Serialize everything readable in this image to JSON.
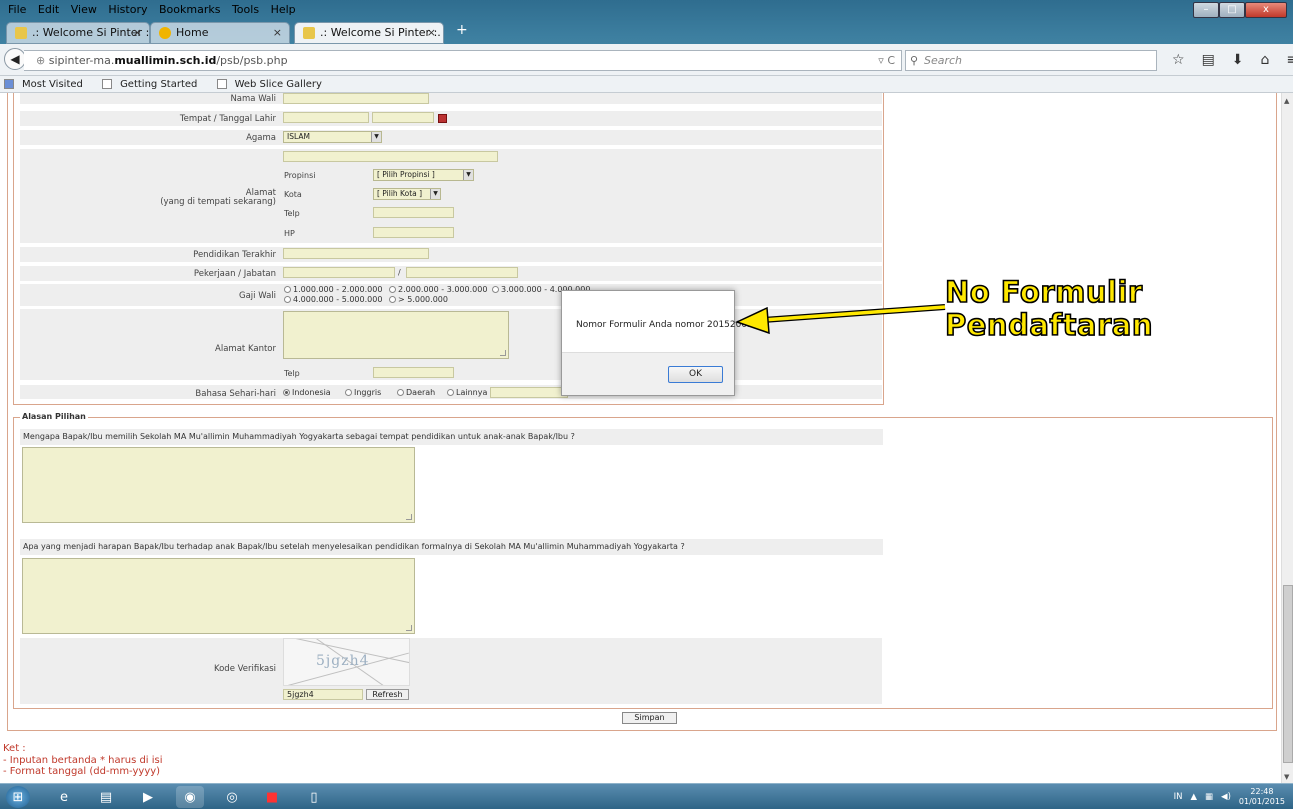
{
  "browser": {
    "menu": [
      "File",
      "Edit",
      "View",
      "History",
      "Bookmarks",
      "Tools",
      "Help"
    ],
    "tabs": [
      {
        "label": ".: Welcome Si Pinter :.",
        "close": "×"
      },
      {
        "label": "Home",
        "close": "×"
      },
      {
        "label": ".: Welcome Si Pinter :.",
        "close": "×"
      }
    ],
    "new_tab": "+",
    "url_prefix": "sipinter-ma.",
    "url_domain": "muallimin.sch.id",
    "url_path": "/psb/psb.php",
    "url_end": "▿ C",
    "search_placeholder": "Search",
    "bookmarks": [
      "Most Visited",
      "Getting Started",
      "Web Slice Gallery"
    ],
    "window_buttons": {
      "min": "–",
      "max": "□",
      "close": "x"
    }
  },
  "form": {
    "nama_wali": "Nama Wali",
    "tempat_tgl": "Tempat / Tanggal Lahir",
    "slash": "/",
    "agama": "Agama",
    "agama_value": "ISLAM",
    "propinsi": "Propinsi",
    "propinsi_value": "[ Pilih Propinsi ]",
    "alamat": "Alamat",
    "alamat_sub": "(yang di tempati sekarang)",
    "kota": "Kota",
    "kota_value": "[ Pilih Kota ]",
    "telp": "Telp",
    "hp": "HP",
    "pendidikan": "Pendidikan Terakhir",
    "pekerjaan": "Pekerjaan / Jabatan",
    "gaji": "Gaji Wali",
    "gaji_opts": [
      "1.000.000 - 2.000.000",
      "2.000.000 - 3.000.000",
      "3.000.000 - 4.000.000",
      "4.000.000 - 5.000.000",
      "> 5.000.000"
    ],
    "alamat_kantor": "Alamat Kantor",
    "telp2": "Telp",
    "bahasa": "Bahasa Sehari-hari",
    "bahasa_opts": [
      "Indonesia",
      "Inggris",
      "Daerah",
      "Lainnya"
    ]
  },
  "alasan": {
    "legend": "Alasan Pilihan",
    "q1": "Mengapa Bapak/Ibu memilih Sekolah MA Mu'allimin Muhammadiyah Yogyakarta sebagai tempat pendidikan untuk anak-anak Bapak/Ibu ?",
    "q2": "Apa yang menjadi harapan Bapak/Ibu terhadap anak Bapak/Ibu setelah menyelesaikan pendidikan formalnya di Sekolah MA Mu'allimin Muhammadiyah Yogyakarta ?",
    "kode_label": "Kode Verifikasi",
    "captcha_text": "5jgzh4",
    "captcha_input": "5jgzh4",
    "refresh": "Refresh"
  },
  "simpan": "Simpan",
  "ket": {
    "title": "Ket :",
    "line1": "- Inputan bertanda * harus di isi",
    "line2": "- Format tanggal (dd-mm-yyyy)"
  },
  "dialog": {
    "message": "Nomor Formulir Anda nomor 20152003",
    "ok": "OK"
  },
  "annotation": {
    "line1": "No Formulir",
    "line2": "Pendaftaran",
    "color": "#ffe800"
  },
  "tray": {
    "lang": "IN",
    "time": "22:48",
    "date": "01/01/2015"
  }
}
